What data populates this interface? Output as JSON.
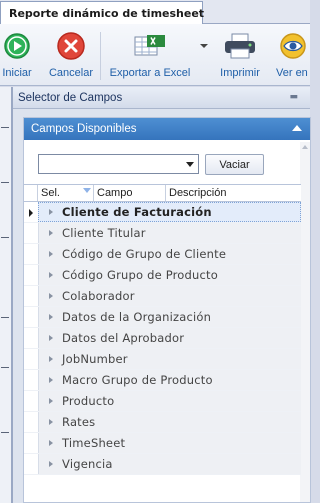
{
  "window": {
    "tab_title": "Reporte dinámico de timesheet"
  },
  "toolbar": {
    "buttons": [
      {
        "label": "Iniciar",
        "icon": "play-icon"
      },
      {
        "label": "Cancelar",
        "icon": "cancel-icon"
      },
      {
        "label": "Exportar a Excel",
        "icon": "excel-icon"
      },
      {
        "label": "Imprimir",
        "icon": "printer-icon"
      },
      {
        "label": "Ver en",
        "icon": "eye-icon"
      }
    ]
  },
  "panel": {
    "title": "Selector de Campos",
    "group_title": "Campos Disponibles",
    "filter_value": "",
    "clear_label": "Vaciar"
  },
  "grid": {
    "columns": [
      "Sel.",
      "Campo",
      "Descripción"
    ],
    "rows": [
      "Cliente de Facturación",
      "Cliente Titular",
      "Código de Grupo de Cliente",
      "Código Grupo de Producto",
      "Colaborador",
      "Datos de la Organización",
      "Datos del Aprobador",
      "JobNumber",
      "Macro Grupo de Producto",
      "Producto",
      "Rates",
      "TimeSheet",
      "Vigencia"
    ],
    "current_row": 0
  },
  "colors": {
    "accent": "#3574bd",
    "link_text": "#1f5fa8"
  }
}
